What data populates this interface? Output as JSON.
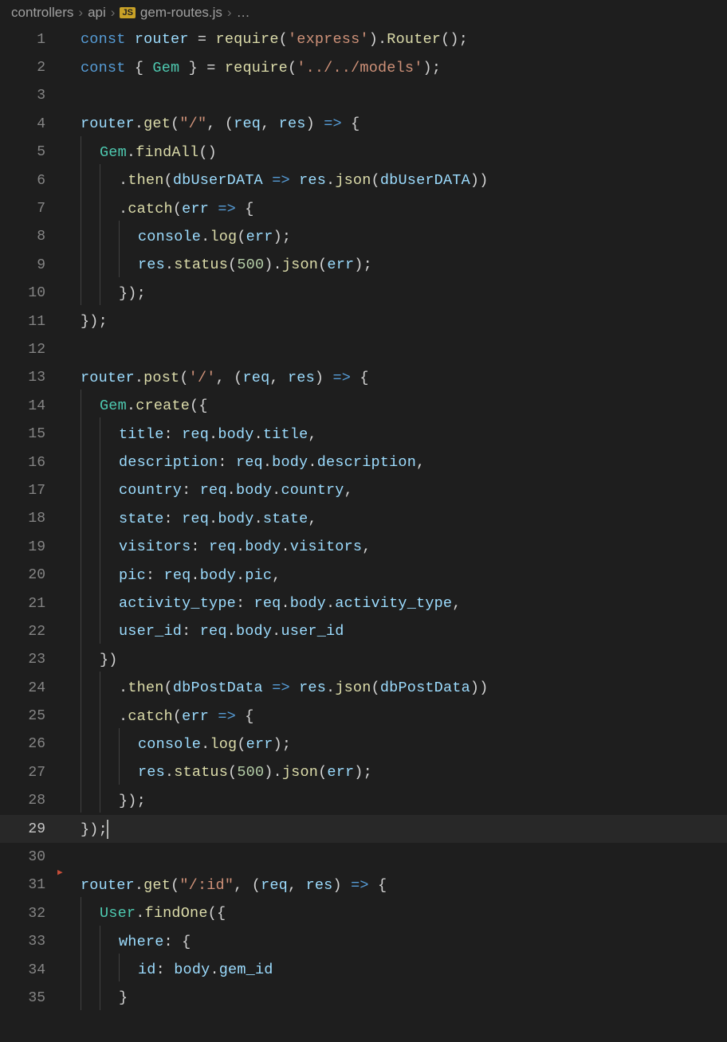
{
  "breadcrumb": {
    "folder1": "controllers",
    "folder2": "api",
    "file": "gem-routes.js",
    "trailing": "…",
    "js_label": "JS"
  },
  "lines": [
    {
      "n": "1",
      "i": 0,
      "tokens": [
        [
          "kw2",
          "const "
        ],
        [
          "var",
          "router"
        ],
        [
          "punct",
          " = "
        ],
        [
          "fn",
          "require"
        ],
        [
          "punct",
          "("
        ],
        [
          "str",
          "'express'"
        ],
        [
          "punct",
          ")."
        ],
        [
          "fn",
          "Router"
        ],
        [
          "punct",
          "();"
        ]
      ]
    },
    {
      "n": "2",
      "i": 0,
      "tokens": [
        [
          "kw2",
          "const "
        ],
        [
          "punct",
          "{ "
        ],
        [
          "type",
          "Gem"
        ],
        [
          "punct",
          " } = "
        ],
        [
          "fn",
          "require"
        ],
        [
          "punct",
          "("
        ],
        [
          "str",
          "'../../models'"
        ],
        [
          "punct",
          ");"
        ]
      ]
    },
    {
      "n": "3",
      "i": 0,
      "tokens": []
    },
    {
      "n": "4",
      "i": 0,
      "tokens": [
        [
          "var",
          "router"
        ],
        [
          "punct",
          "."
        ],
        [
          "fn",
          "get"
        ],
        [
          "punct",
          "("
        ],
        [
          "str",
          "\"/\""
        ],
        [
          "punct",
          ", ("
        ],
        [
          "param",
          "req"
        ],
        [
          "punct",
          ", "
        ],
        [
          "param",
          "res"
        ],
        [
          "punct",
          ") "
        ],
        [
          "arrow",
          "=>"
        ],
        [
          "punct",
          " {"
        ]
      ]
    },
    {
      "n": "5",
      "i": 1,
      "tokens": [
        [
          "type",
          "Gem"
        ],
        [
          "punct",
          "."
        ],
        [
          "fn",
          "findAll"
        ],
        [
          "punct",
          "()"
        ]
      ]
    },
    {
      "n": "6",
      "i": 2,
      "tokens": [
        [
          "punct",
          "."
        ],
        [
          "fn",
          "then"
        ],
        [
          "punct",
          "("
        ],
        [
          "param",
          "dbUserDATA"
        ],
        [
          "punct",
          " "
        ],
        [
          "arrow",
          "=>"
        ],
        [
          "punct",
          " "
        ],
        [
          "var",
          "res"
        ],
        [
          "punct",
          "."
        ],
        [
          "fn",
          "json"
        ],
        [
          "punct",
          "("
        ],
        [
          "var",
          "dbUserDATA"
        ],
        [
          "punct",
          "))"
        ]
      ]
    },
    {
      "n": "7",
      "i": 2,
      "tokens": [
        [
          "punct",
          "."
        ],
        [
          "fn",
          "catch"
        ],
        [
          "punct",
          "("
        ],
        [
          "param",
          "err"
        ],
        [
          "punct",
          " "
        ],
        [
          "arrow",
          "=>"
        ],
        [
          "punct",
          " {"
        ]
      ]
    },
    {
      "n": "8",
      "i": 3,
      "tokens": [
        [
          "var",
          "console"
        ],
        [
          "punct",
          "."
        ],
        [
          "fn",
          "log"
        ],
        [
          "punct",
          "("
        ],
        [
          "var",
          "err"
        ],
        [
          "punct",
          ");"
        ]
      ]
    },
    {
      "n": "9",
      "i": 3,
      "tokens": [
        [
          "var",
          "res"
        ],
        [
          "punct",
          "."
        ],
        [
          "fn",
          "status"
        ],
        [
          "punct",
          "("
        ],
        [
          "num",
          "500"
        ],
        [
          "punct",
          ")."
        ],
        [
          "fn",
          "json"
        ],
        [
          "punct",
          "("
        ],
        [
          "var",
          "err"
        ],
        [
          "punct",
          ");"
        ]
      ]
    },
    {
      "n": "10",
      "i": 2,
      "tokens": [
        [
          "punct",
          "});"
        ]
      ]
    },
    {
      "n": "11",
      "i": 0,
      "tokens": [
        [
          "punct",
          "});"
        ]
      ]
    },
    {
      "n": "12",
      "i": 0,
      "tokens": []
    },
    {
      "n": "13",
      "i": 0,
      "tokens": [
        [
          "var",
          "router"
        ],
        [
          "punct",
          "."
        ],
        [
          "fn",
          "post"
        ],
        [
          "punct",
          "("
        ],
        [
          "str",
          "'/'"
        ],
        [
          "punct",
          ", ("
        ],
        [
          "param",
          "req"
        ],
        [
          "punct",
          ", "
        ],
        [
          "param",
          "res"
        ],
        [
          "punct",
          ") "
        ],
        [
          "arrow",
          "=>"
        ],
        [
          "punct",
          " {"
        ]
      ]
    },
    {
      "n": "14",
      "i": 1,
      "tokens": [
        [
          "type",
          "Gem"
        ],
        [
          "punct",
          "."
        ],
        [
          "fn",
          "create"
        ],
        [
          "punct",
          "({"
        ]
      ]
    },
    {
      "n": "15",
      "i": 2,
      "tokens": [
        [
          "prop",
          "title"
        ],
        [
          "punct",
          ": "
        ],
        [
          "var",
          "req"
        ],
        [
          "punct",
          "."
        ],
        [
          "var",
          "body"
        ],
        [
          "punct",
          "."
        ],
        [
          "var",
          "title"
        ],
        [
          "punct",
          ","
        ]
      ]
    },
    {
      "n": "16",
      "i": 2,
      "tokens": [
        [
          "prop",
          "description"
        ],
        [
          "punct",
          ": "
        ],
        [
          "var",
          "req"
        ],
        [
          "punct",
          "."
        ],
        [
          "var",
          "body"
        ],
        [
          "punct",
          "."
        ],
        [
          "var",
          "description"
        ],
        [
          "punct",
          ","
        ]
      ]
    },
    {
      "n": "17",
      "i": 2,
      "tokens": [
        [
          "prop",
          "country"
        ],
        [
          "punct",
          ": "
        ],
        [
          "var",
          "req"
        ],
        [
          "punct",
          "."
        ],
        [
          "var",
          "body"
        ],
        [
          "punct",
          "."
        ],
        [
          "var",
          "country"
        ],
        [
          "punct",
          ","
        ]
      ]
    },
    {
      "n": "18",
      "i": 2,
      "tokens": [
        [
          "prop",
          "state"
        ],
        [
          "punct",
          ": "
        ],
        [
          "var",
          "req"
        ],
        [
          "punct",
          "."
        ],
        [
          "var",
          "body"
        ],
        [
          "punct",
          "."
        ],
        [
          "var",
          "state"
        ],
        [
          "punct",
          ","
        ]
      ]
    },
    {
      "n": "19",
      "i": 2,
      "tokens": [
        [
          "prop",
          "visitors"
        ],
        [
          "punct",
          ": "
        ],
        [
          "var",
          "req"
        ],
        [
          "punct",
          "."
        ],
        [
          "var",
          "body"
        ],
        [
          "punct",
          "."
        ],
        [
          "var",
          "visitors"
        ],
        [
          "punct",
          ","
        ]
      ]
    },
    {
      "n": "20",
      "i": 2,
      "tokens": [
        [
          "prop",
          "pic"
        ],
        [
          "punct",
          ": "
        ],
        [
          "var",
          "req"
        ],
        [
          "punct",
          "."
        ],
        [
          "var",
          "body"
        ],
        [
          "punct",
          "."
        ],
        [
          "var",
          "pic"
        ],
        [
          "punct",
          ","
        ]
      ]
    },
    {
      "n": "21",
      "i": 2,
      "tokens": [
        [
          "prop",
          "activity_type"
        ],
        [
          "punct",
          ": "
        ],
        [
          "var",
          "req"
        ],
        [
          "punct",
          "."
        ],
        [
          "var",
          "body"
        ],
        [
          "punct",
          "."
        ],
        [
          "var",
          "activity_type"
        ],
        [
          "punct",
          ","
        ]
      ]
    },
    {
      "n": "22",
      "i": 2,
      "tokens": [
        [
          "prop",
          "user_id"
        ],
        [
          "punct",
          ": "
        ],
        [
          "var",
          "req"
        ],
        [
          "punct",
          "."
        ],
        [
          "var",
          "body"
        ],
        [
          "punct",
          "."
        ],
        [
          "var",
          "user_id"
        ]
      ]
    },
    {
      "n": "23",
      "i": 1,
      "tokens": [
        [
          "punct",
          "})"
        ]
      ]
    },
    {
      "n": "24",
      "i": 2,
      "tokens": [
        [
          "punct",
          "."
        ],
        [
          "fn",
          "then"
        ],
        [
          "punct",
          "("
        ],
        [
          "param",
          "dbPostData"
        ],
        [
          "punct",
          " "
        ],
        [
          "arrow",
          "=>"
        ],
        [
          "punct",
          " "
        ],
        [
          "var",
          "res"
        ],
        [
          "punct",
          "."
        ],
        [
          "fn",
          "json"
        ],
        [
          "punct",
          "("
        ],
        [
          "var",
          "dbPostData"
        ],
        [
          "punct",
          "))"
        ]
      ]
    },
    {
      "n": "25",
      "i": 2,
      "tokens": [
        [
          "punct",
          "."
        ],
        [
          "fn",
          "catch"
        ],
        [
          "punct",
          "("
        ],
        [
          "param",
          "err"
        ],
        [
          "punct",
          " "
        ],
        [
          "arrow",
          "=>"
        ],
        [
          "punct",
          " {"
        ]
      ]
    },
    {
      "n": "26",
      "i": 3,
      "tokens": [
        [
          "var",
          "console"
        ],
        [
          "punct",
          "."
        ],
        [
          "fn",
          "log"
        ],
        [
          "punct",
          "("
        ],
        [
          "var",
          "err"
        ],
        [
          "punct",
          ");"
        ]
      ]
    },
    {
      "n": "27",
      "i": 3,
      "tokens": [
        [
          "var",
          "res"
        ],
        [
          "punct",
          "."
        ],
        [
          "fn",
          "status"
        ],
        [
          "punct",
          "("
        ],
        [
          "num",
          "500"
        ],
        [
          "punct",
          ")."
        ],
        [
          "fn",
          "json"
        ],
        [
          "punct",
          "("
        ],
        [
          "var",
          "err"
        ],
        [
          "punct",
          ");"
        ]
      ]
    },
    {
      "n": "28",
      "i": 2,
      "tokens": [
        [
          "punct",
          "});"
        ]
      ]
    },
    {
      "n": "29",
      "i": 0,
      "current": true,
      "tokens": [
        [
          "punct",
          "});"
        ],
        [
          "cursor",
          ""
        ]
      ]
    },
    {
      "n": "30",
      "i": 0,
      "tokens": []
    },
    {
      "n": "31",
      "i": 0,
      "fold": true,
      "tokens": [
        [
          "var",
          "router"
        ],
        [
          "punct",
          "."
        ],
        [
          "fn",
          "get"
        ],
        [
          "punct",
          "("
        ],
        [
          "str",
          "\"/:id\""
        ],
        [
          "punct",
          ", ("
        ],
        [
          "param",
          "req"
        ],
        [
          "punct",
          ", "
        ],
        [
          "param",
          "res"
        ],
        [
          "punct",
          ") "
        ],
        [
          "arrow",
          "=>"
        ],
        [
          "punct",
          " {"
        ]
      ]
    },
    {
      "n": "32",
      "i": 1,
      "tokens": [
        [
          "type",
          "User"
        ],
        [
          "punct",
          "."
        ],
        [
          "fn",
          "findOne"
        ],
        [
          "punct",
          "({"
        ]
      ]
    },
    {
      "n": "33",
      "i": 2,
      "tokens": [
        [
          "prop",
          "where"
        ],
        [
          "punct",
          ": {"
        ]
      ]
    },
    {
      "n": "34",
      "i": 3,
      "tokens": [
        [
          "prop",
          "id"
        ],
        [
          "punct",
          ": "
        ],
        [
          "var",
          "body"
        ],
        [
          "punct",
          "."
        ],
        [
          "var",
          "gem_id"
        ]
      ]
    },
    {
      "n": "35",
      "i": 2,
      "tokens": [
        [
          "punct",
          "}"
        ]
      ]
    }
  ]
}
